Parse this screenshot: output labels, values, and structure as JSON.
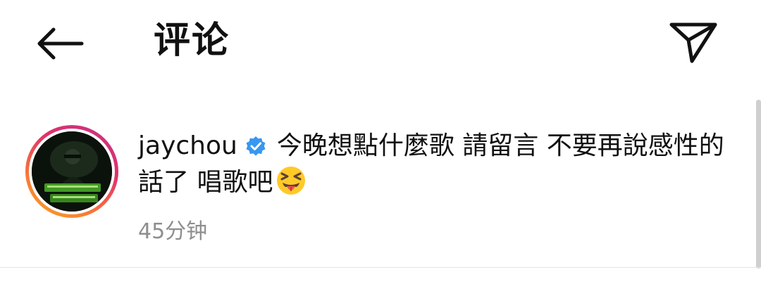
{
  "header": {
    "back_icon": "arrow-left-icon",
    "title": "评论",
    "share_icon": "send-icon"
  },
  "comment": {
    "avatar_icon": "user-avatar",
    "avatar_ring_colors": [
      "#f9a825",
      "#e1306c",
      "#c13584"
    ],
    "username": "jaychou",
    "verified_icon": "verified-badge-icon",
    "verified_color": "#3897f0",
    "text": "今晚想點什麼歌 請留言 不要再說感性的話了 唱歌吧",
    "emoji": "squinting-face-with-tongue",
    "timestamp": "45分钟"
  }
}
